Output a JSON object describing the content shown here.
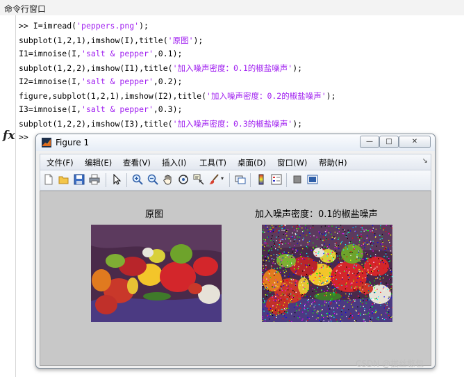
{
  "command_window": {
    "header_title": "命令行窗口",
    "lines": [
      {
        "prompt": ">> ",
        "code_a": "I=imread(",
        "str_a": "'peppers.png'",
        "code_b": ");",
        "str_b": "",
        "code_c": ""
      },
      {
        "prompt": "",
        "code_a": "subplot(1,2,1),imshow(I),title(",
        "str_a": "'原图'",
        "code_b": ");",
        "str_b": "",
        "code_c": ""
      },
      {
        "prompt": "",
        "code_a": "I1=imnoise(I,",
        "str_a": "'salt & pepper'",
        "code_b": ",0.1);",
        "str_b": "",
        "code_c": ""
      },
      {
        "prompt": "",
        "code_a": "subplot(1,2,2),imshow(I1),title(",
        "str_a": "'加入噪声密度：0.1的椒盐噪声'",
        "code_b": ");",
        "str_b": "",
        "code_c": ""
      },
      {
        "prompt": "",
        "code_a": "I2=imnoise(I,",
        "str_a": "'salt & pepper'",
        "code_b": ",0.2);",
        "str_b": "",
        "code_c": ""
      },
      {
        "prompt": "",
        "code_a": "figure,subplot(1,2,1),imshow(I2),title(",
        "str_a": "'加入噪声密度：0.2的椒盐噪声'",
        "code_b": ");",
        "str_b": "",
        "code_c": ""
      },
      {
        "prompt": "",
        "code_a": "I3=imnoise(I,",
        "str_a": "'salt & pepper'",
        "code_b": ",0.3);",
        "str_b": "",
        "code_c": ""
      },
      {
        "prompt": "",
        "code_a": "subplot(1,2,2),imshow(I3),title(",
        "str_a": "'加入噪声密度：0.3的椒盐噪声'",
        "code_b": ");",
        "str_b": "",
        "code_c": ""
      }
    ],
    "fx_label": "fx",
    "active_prompt": ">>"
  },
  "figure": {
    "title": "Figure 1",
    "window_buttons": {
      "minimize": "—",
      "maximize": "□",
      "close": "✕"
    },
    "menus": [
      "文件(F)",
      "编辑(E)",
      "查看(V)",
      "插入(I)",
      "工具(T)",
      "桌面(D)",
      "窗口(W)",
      "帮助(H)"
    ],
    "menu_overflow": "↘",
    "toolbar_icons": [
      "new-figure-icon",
      "open-file-icon",
      "save-icon",
      "print-icon",
      "select-arrow-icon",
      "zoom-in-icon",
      "zoom-out-icon",
      "pan-hand-icon",
      "rotate-3d-icon",
      "data-cursor-icon",
      "brush-icon",
      "link-plot-icon",
      "colorbar-icon",
      "legend-icon",
      "hide-plot-tools-icon",
      "show-plot-tools-icon"
    ],
    "axes": [
      {
        "title": "原图"
      },
      {
        "title": "加入噪声密度：0.1的椒盐噪声"
      }
    ]
  },
  "watermark": "CSDN @拔丝憨包",
  "colors": {
    "string_literal": "#a020f0",
    "figure_bg": "#c8c8c8"
  }
}
